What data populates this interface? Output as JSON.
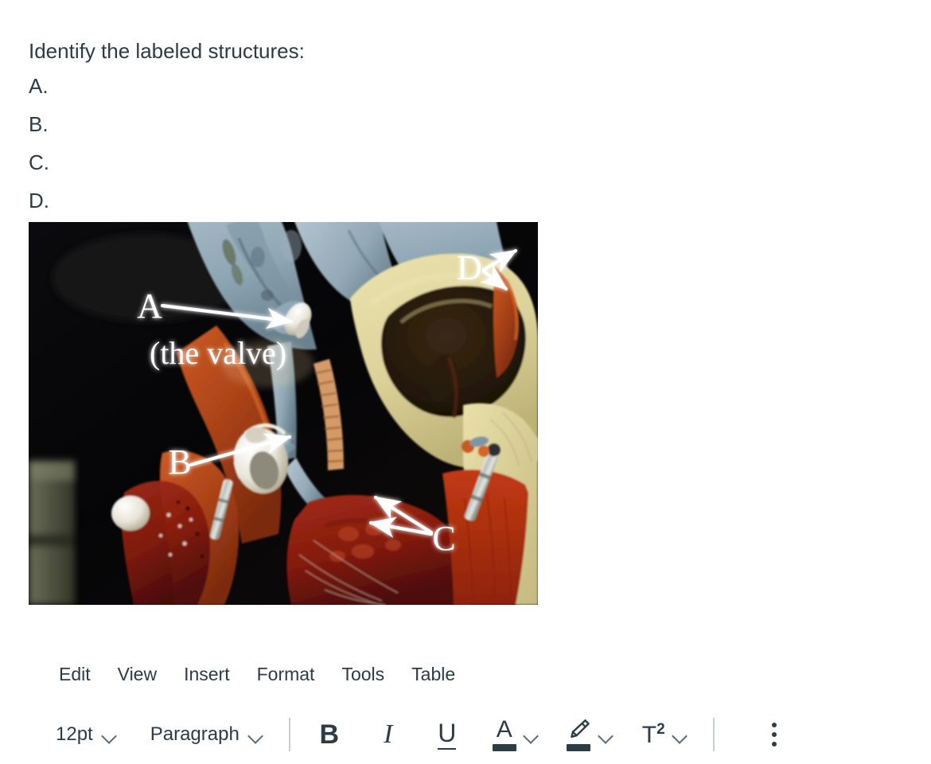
{
  "question": {
    "prompt": "Identify the labeled structures:",
    "answers": [
      "A.",
      "B.",
      "C.",
      "D."
    ]
  },
  "figure": {
    "alt": "Anatomical heart model cross-section with labeled arrows",
    "labels": [
      {
        "id": "A",
        "text": "A",
        "note": "(the valve)"
      },
      {
        "id": "B",
        "text": "B",
        "note": ""
      },
      {
        "id": "C",
        "text": "C",
        "note": ""
      },
      {
        "id": "D",
        "text": "D",
        "note": ""
      }
    ],
    "colors": {
      "background": "#07070a",
      "vessel_blue": "#8fa6b4",
      "muscle_rust": "#b5441a",
      "myocardium_red": "#8e1d10",
      "cream": "#ded5a0",
      "pale_yellow": "#e8e0ac",
      "metal": "#c9ccc8",
      "olive_panel": "#6f7257",
      "arrow_white": "#ffffff"
    }
  },
  "editor": {
    "menubar": [
      {
        "label": "Edit"
      },
      {
        "label": "View"
      },
      {
        "label": "Insert"
      },
      {
        "label": "Format"
      },
      {
        "label": "Tools"
      },
      {
        "label": "Table"
      }
    ],
    "toolbar": {
      "font_size": "12pt",
      "block_format": "Paragraph",
      "bold_label": "B",
      "italic_label": "I",
      "underline_label": "U",
      "text_color_label": "A",
      "superscript_label": "T",
      "superscript_exponent": "2",
      "text_color_swatch": "#2D3B45",
      "highlight_swatch": "#2D3B45",
      "more_label": "⋮"
    }
  }
}
